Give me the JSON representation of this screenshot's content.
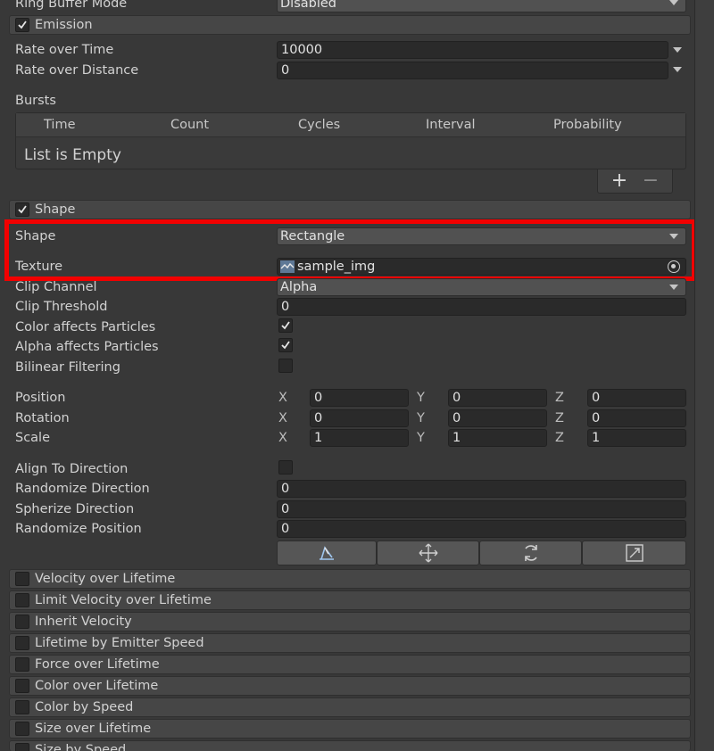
{
  "ring_buffer": {
    "label": "Ring Buffer Mode",
    "value": "Disabled"
  },
  "emission": {
    "title": "Emission",
    "enabled": true,
    "rate_over_time": {
      "label": "Rate over Time",
      "value": "10000"
    },
    "rate_over_distance": {
      "label": "Rate over Distance",
      "value": "0"
    },
    "bursts": {
      "label": "Bursts",
      "columns": [
        "Time",
        "Count",
        "Cycles",
        "Interval",
        "Probability"
      ],
      "empty_text": "List is Empty",
      "add_label": "+",
      "remove_label": "−"
    }
  },
  "shape": {
    "title": "Shape",
    "enabled": true,
    "shape": {
      "label": "Shape",
      "value": "Rectangle"
    },
    "texture": {
      "label": "Texture",
      "value": "sample_img",
      "icon": "texture-thumbnail-icon"
    },
    "clip_channel": {
      "label": "Clip Channel",
      "value": "Alpha"
    },
    "clip_threshold": {
      "label": "Clip Threshold",
      "value": "0"
    },
    "color_affects": {
      "label": "Color affects Particles",
      "checked": true
    },
    "alpha_affects": {
      "label": "Alpha affects Particles",
      "checked": true
    },
    "bilinear": {
      "label": "Bilinear Filtering",
      "checked": false
    },
    "position": {
      "label": "Position",
      "x": "0",
      "y": "0",
      "z": "0"
    },
    "rotation": {
      "label": "Rotation",
      "x": "0",
      "y": "0",
      "z": "0"
    },
    "scale": {
      "label": "Scale",
      "x": "1",
      "y": "1",
      "z": "1"
    },
    "axis_labels": {
      "x": "X",
      "y": "Y",
      "z": "Z"
    },
    "align_to_direction": {
      "label": "Align To Direction",
      "checked": false
    },
    "randomize_direction": {
      "label": "Randomize Direction",
      "value": "0"
    },
    "spherize_direction": {
      "label": "Spherize Direction",
      "value": "0"
    },
    "randomize_position": {
      "label": "Randomize Position",
      "value": "0"
    },
    "tools": [
      "edit-shape-icon",
      "move-icon",
      "rotate-icon",
      "scale-icon"
    ]
  },
  "modules": [
    {
      "label": "Velocity over Lifetime",
      "enabled": false
    },
    {
      "label": "Limit Velocity over Lifetime",
      "enabled": false
    },
    {
      "label": "Inherit Velocity",
      "enabled": false
    },
    {
      "label": "Lifetime by Emitter Speed",
      "enabled": false
    },
    {
      "label": "Force over Lifetime",
      "enabled": false
    },
    {
      "label": "Color over Lifetime",
      "enabled": false
    },
    {
      "label": "Color by Speed",
      "enabled": false
    },
    {
      "label": "Size over Lifetime",
      "enabled": false
    },
    {
      "label": "Size by Speed",
      "enabled": false
    }
  ],
  "colors": {
    "highlight": "#f20000",
    "background": "#383838"
  }
}
